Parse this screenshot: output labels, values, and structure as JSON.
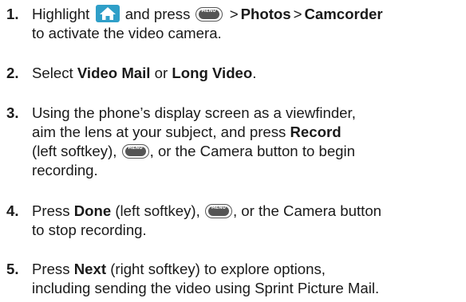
{
  "steps": [
    {
      "number": "1.",
      "line1_a": "Highlight",
      "line1_b": "and press",
      "menu_path_1": "Photos",
      "menu_path_2": "Camcorder",
      "arrow": ">",
      "line2": "to activate the video camera."
    },
    {
      "number": "2.",
      "pre": "Select",
      "option_a": "Video Mail",
      "mid": "or",
      "option_b": "Long Video",
      "end": "."
    },
    {
      "number": "3.",
      "line1": "Using the phone’s display screen as a viewfinder,",
      "line2_a": "aim the lens at your subject, and press",
      "line2_b": "Record",
      "line3_a": "(left softkey),",
      "line3_b": ", or the Camera button to begin",
      "line4": "recording."
    },
    {
      "number": "4.",
      "line1_a": "Press",
      "line1_b": "Done",
      "line1_c": "(left softkey),",
      "line1_d": ", or the Camera button",
      "line2": "to stop recording."
    },
    {
      "number": "5.",
      "line1_a": "Press",
      "line1_b": "Next",
      "line1_c": "(right softkey) to explore options,",
      "line2": "including sending the video using Sprint Picture Mail."
    }
  ],
  "icons": {
    "home_key": "home-key-icon",
    "menu_ok_key": "menu-ok-key-icon",
    "menu_ok_label_top": "MENU",
    "menu_ok_label_bottom": "OK",
    "home_key_color": "#2f9fc8"
  }
}
